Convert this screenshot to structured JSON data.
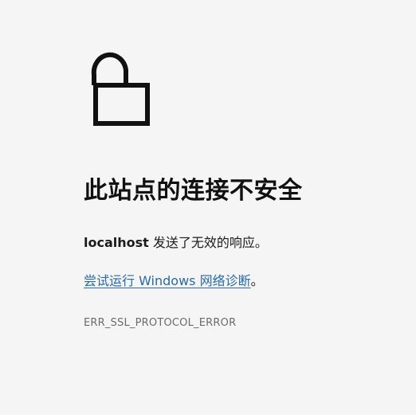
{
  "icon": "unlocked-padlock-icon",
  "headline": "此站点的连接不安全",
  "message": {
    "host": "localhost",
    "text": " 发送了无效的响应。"
  },
  "diagnostics": {
    "link_text": "尝试运行 Windows 网络诊断",
    "suffix": "。"
  },
  "error_code": "ERR_SSL_PROTOCOL_ERROR",
  "colors": {
    "background": "#f5f5f5",
    "link": "#2a6aa6",
    "error_code": "#6b6b6b"
  }
}
